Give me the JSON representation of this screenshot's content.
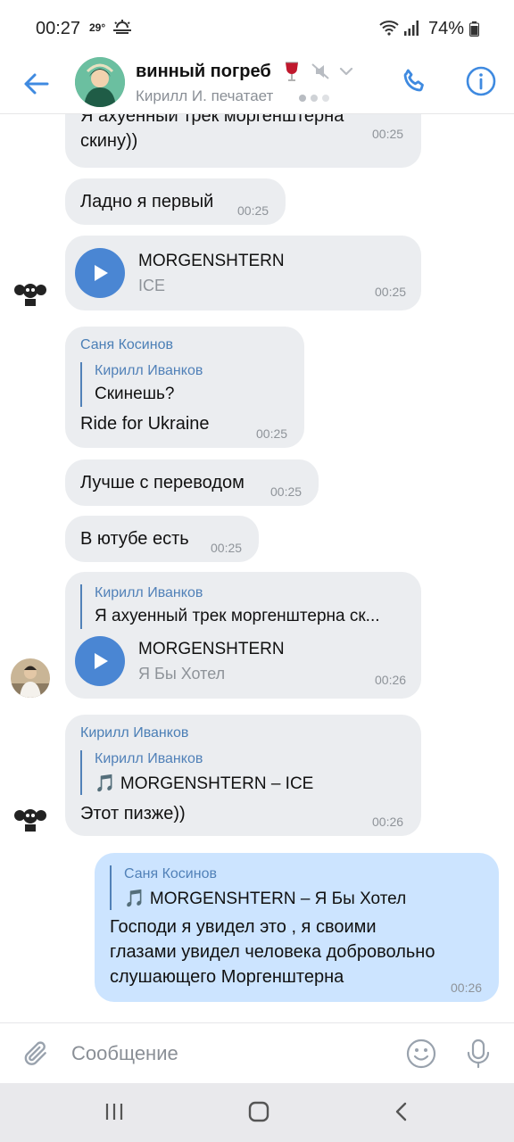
{
  "status_bar": {
    "time": "00:27",
    "temperature": "29°",
    "battery": "74%",
    "weather_icon": "sun-haze-icon",
    "wifi_icon": "wifi-icon",
    "signal_icon": "signal-icon",
    "battery_icon": "battery-icon"
  },
  "header": {
    "title": "винный погреб",
    "status": "Кирилл И. печатает",
    "accent_color": "#3f8ae0"
  },
  "messages": [
    {
      "text": "Я ахуенный трек моргенштерна скину))",
      "time": "00:25"
    },
    {
      "text": "Ладно я первый",
      "time": "00:25"
    },
    {
      "audio_title": "MORGENSHTERN",
      "audio_subtitle": "ICE",
      "time": "00:25"
    },
    {
      "sender": "Саня Косинов",
      "reply_name": "Кирилл Иванков",
      "reply_text": "Скинешь?",
      "text": "Ride for Ukraine",
      "time": "00:25"
    },
    {
      "text": "Лучше с переводом",
      "time": "00:25"
    },
    {
      "text": "В ютубе есть",
      "time": "00:25"
    },
    {
      "reply_name": "Кирилл Иванков",
      "reply_text": "Я ахуенный трек моргенштерна ск...",
      "audio_title": "MORGENSHTERN",
      "audio_subtitle": "Я Бы Хотел",
      "time": "00:26"
    },
    {
      "sender": "Кирилл Иванков",
      "reply_name": "Кирилл Иванков",
      "reply_text": "🎵 MORGENSHTERN – ICE",
      "text": "Этот пизже))",
      "time": "00:26"
    },
    {
      "reply_name": "Саня Косинов",
      "reply_text": "🎵 MORGENSHTERN – Я Бы Хотел",
      "text_lines": [
        "Господи я увидел это , я своими",
        "глазами увидел человека добровольно",
        "слушающего Моргенштерна"
      ],
      "time": "00:26"
    }
  ],
  "composer": {
    "placeholder": "Сообщение"
  },
  "colors": {
    "incoming_bubble": "#ebedf0",
    "outgoing_bubble": "#cce4ff",
    "play_button": "#4a86d3",
    "link_blue": "#5181b8"
  }
}
